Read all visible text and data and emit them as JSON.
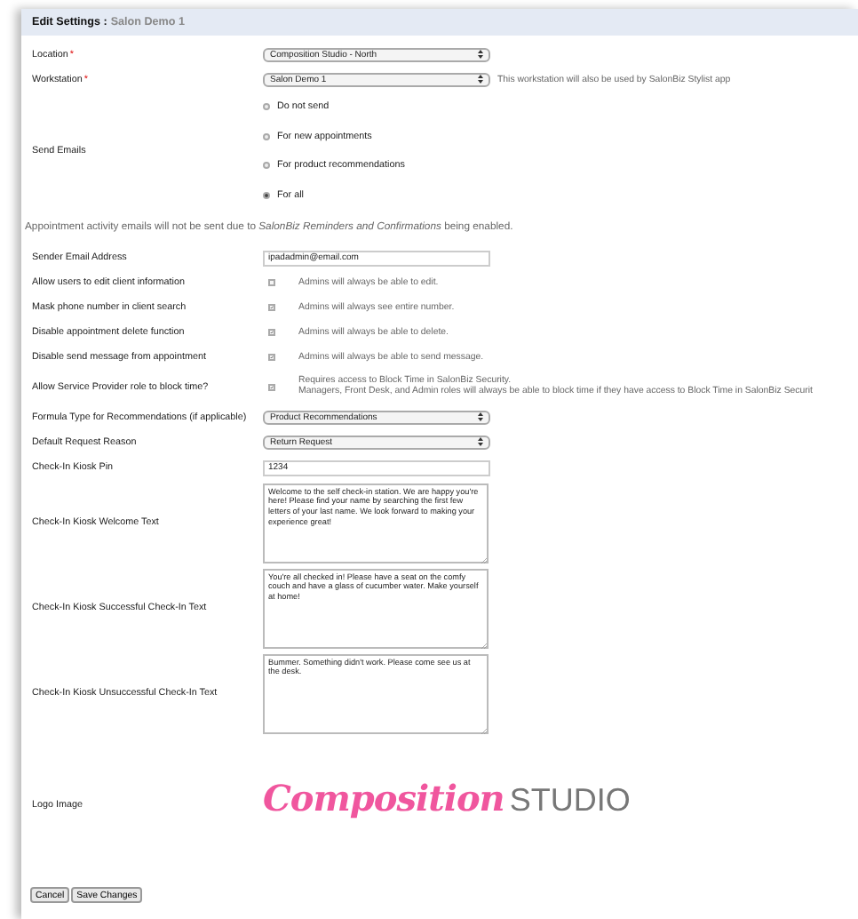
{
  "header": {
    "title": "Edit Settings :",
    "subtitle": "Salon Demo 1"
  },
  "rows": [
    {
      "kind": "select",
      "label": "Location",
      "required_mark": "*",
      "value": "Composition Studio - North"
    },
    {
      "kind": "select",
      "label": "Workstation",
      "required_mark": "*",
      "value": "Salon Demo 1",
      "note": "This workstation will also be used by SalonBiz Stylist app"
    },
    {
      "kind": "radio",
      "label": "Send Emails",
      "options": [
        {
          "label": "Do not send",
          "selected": false
        },
        {
          "label": "For new appointments",
          "selected": false
        },
        {
          "label": "For product recommendations",
          "selected": false
        },
        {
          "label": "For all",
          "selected": true
        }
      ]
    },
    {
      "kind": "notice",
      "text": "Appointment activity emails will not be sent due to *SalonBiz Reminders and Confirmations* being enabled."
    },
    {
      "kind": "text",
      "label": "Sender Email Address",
      "value": "ipadadmin@email.com"
    },
    {
      "kind": "checkbox",
      "label": "Allow users to edit client information",
      "checked": false,
      "note": "Admins will always be able to edit."
    },
    {
      "kind": "checkbox",
      "label": "Mask phone number in client search",
      "checked": true,
      "note": "Admins will always see entire number."
    },
    {
      "kind": "checkbox",
      "label": "Disable appointment delete function",
      "checked": true,
      "note": "Admins will always be able to delete."
    },
    {
      "kind": "checkbox",
      "label": "Disable send message from appointment",
      "checked": true,
      "note": "Admins will always be able to send message."
    },
    {
      "kind": "checkbox",
      "label": "Allow Service Provider role to block time?",
      "checked": true,
      "note": "Requires access to Block Time in SalonBiz Security.",
      "note_2": "Managers, Front Desk, and Admin roles will always be able to block time if they have access to Block Time in SalonBiz Securit"
    },
    {
      "kind": "select",
      "label": "Formula Type for Recommendations (if applicable)",
      "value": "Product Recommendations"
    },
    {
      "kind": "select",
      "label": "Default Request Reason",
      "value": "Return Request"
    },
    {
      "kind": "text",
      "label": "Check-In Kiosk Pin",
      "value": "1234"
    },
    {
      "kind": "textarea",
      "label": "Check-In Kiosk Welcome Text",
      "value": "Welcome to the self check-in station. We are happy you're here! Please find your name by searching the first few letters of your last name. We look forward to making your experience great!"
    },
    {
      "kind": "textarea",
      "label": "Check-In Kiosk Successful Check-In Text",
      "value": "You're all checked in! Please have a seat on the comfy couch and have a glass of cucumber water. Make yourself at home!"
    },
    {
      "kind": "textarea",
      "label": "Check-In Kiosk Unsuccessful Check-In Text",
      "value": "Bummer. Something didn't work. Please come see us at the desk."
    },
    {
      "kind": "logo",
      "label": "Logo Image",
      "script": "Composition",
      "word": "STUDIO"
    }
  ],
  "buttons": [
    "Cancel",
    "Save Changes"
  ]
}
